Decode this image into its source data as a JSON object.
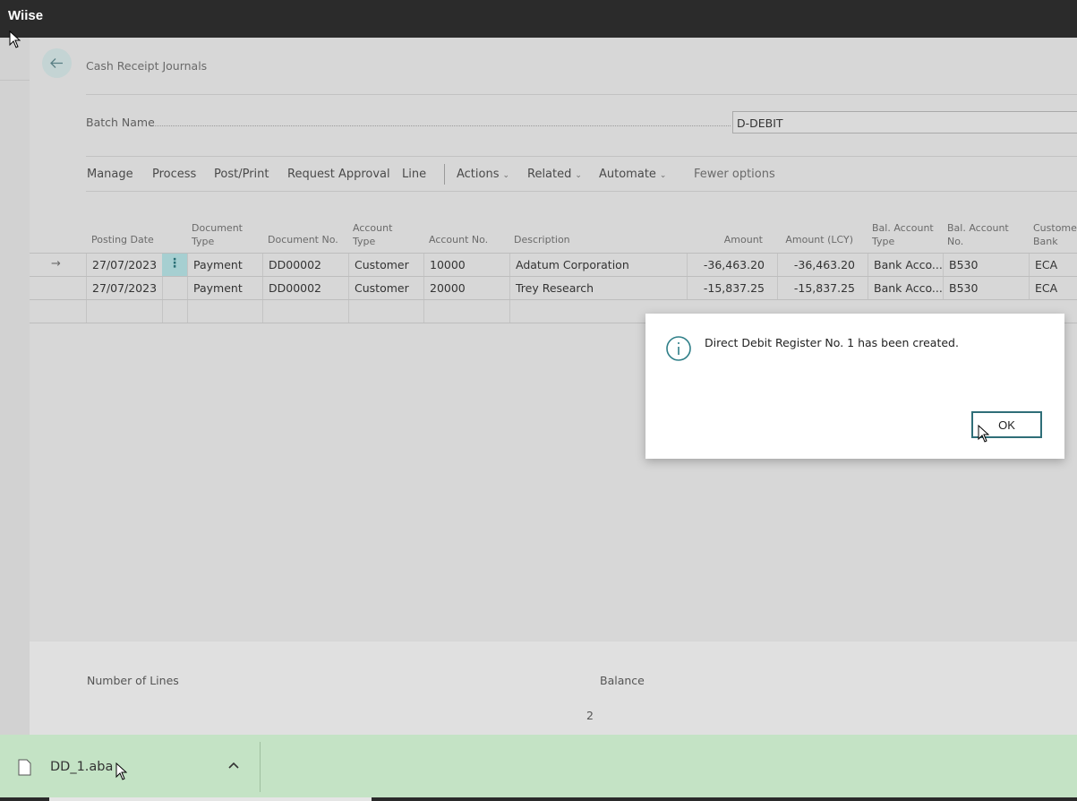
{
  "app": {
    "brand": "Wiise"
  },
  "page": {
    "title": "Cash Receipt Journals"
  },
  "batch": {
    "label": "Batch Name",
    "value": "D-DEBIT"
  },
  "menu": {
    "items": [
      "Manage",
      "Process",
      "Post/Print",
      "Request Approval",
      "Line"
    ],
    "dropdowns": [
      "Actions",
      "Related",
      "Automate"
    ],
    "fewer_options": "Fewer options"
  },
  "columns": {
    "posting_date": "Posting Date",
    "document_type": [
      "Document",
      "Type"
    ],
    "document_no": "Document No.",
    "account_type": [
      "Account",
      "Type"
    ],
    "account_no": "Account No.",
    "description": "Description",
    "amount": "Amount",
    "amount_lcy": "Amount (LCY)",
    "bal_account_type": [
      "Bal. Account",
      "Type"
    ],
    "bal_account_no": [
      "Bal. Account",
      "No."
    ],
    "customer_bank": [
      "Customer",
      "Bank"
    ]
  },
  "rows": [
    {
      "posting_date": "27/07/2023",
      "document_type": "Payment",
      "document_no": "DD00002",
      "account_type": "Customer",
      "account_no": "10000",
      "description": "Adatum Corporation",
      "amount": "-36,463.20",
      "amount_lcy": "-36,463.20",
      "bal_account_type": "Bank Acco...",
      "bal_account_no": "B530",
      "customer_bank": "ECA"
    },
    {
      "posting_date": "27/07/2023",
      "document_type": "Payment",
      "document_no": "DD00002",
      "account_type": "Customer",
      "account_no": "20000",
      "description": "Trey Research",
      "amount": "-15,837.25",
      "amount_lcy": "-15,837.25",
      "bal_account_type": "Bank Acco...",
      "bal_account_no": "B530",
      "customer_bank": "ECA"
    }
  ],
  "footer": {
    "number_of_lines_label": "Number of Lines",
    "balance_label": "Balance",
    "number_of_lines_value": "2"
  },
  "dialog": {
    "message": "Direct Debit Register No. 1 has been created.",
    "ok_label": "OK"
  },
  "downloads": {
    "file_name": "DD_1.aba"
  },
  "icons": [
    "back-arrow-icon",
    "row-arrow-icon",
    "kebab-icon",
    "info-icon",
    "file-icon",
    "chevron-up-icon",
    "chevron-down-icon",
    "mouse-cursor-icon"
  ],
  "colors": {
    "accent": "#2f6e78",
    "selected_cell": "#a6cfd1",
    "download_bar": "#c4e3c5",
    "topbar": "#2b2b2b"
  }
}
